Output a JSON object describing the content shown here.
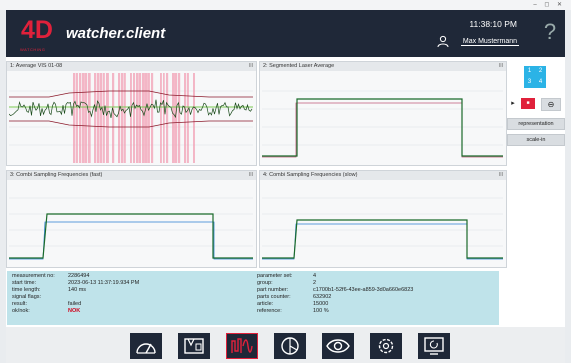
{
  "window": {
    "controls": "– ◻ ✕"
  },
  "header": {
    "logo_text": "4D",
    "logo_sub": "WATCHING",
    "title": "watcher.client",
    "time": "11:38:10 PM",
    "user_name": "Max Mustermann",
    "help_glyph": "?"
  },
  "panels": [
    {
      "title": "1: Average VIS 01-08",
      "menu": "III"
    },
    {
      "title": "2: Segmented Laser Average",
      "menu": "III"
    },
    {
      "title": "3: Combi Sampling Frequencies (fast)",
      "menu": "III"
    },
    {
      "title": "4: Combi Sampling Frequencies (slow)",
      "menu": "III"
    }
  ],
  "info_left": [
    {
      "label": "measurement no:",
      "value": "2286494"
    },
    {
      "label": "start time:",
      "value": "2023-06-13  11:37:19.934 PM"
    },
    {
      "label": "time length:",
      "value": "140 ms"
    },
    {
      "label": "signal flags:",
      "value": ""
    },
    {
      "label": "result:",
      "value": "failed"
    },
    {
      "label": "ok/nok:",
      "value": "NOK"
    }
  ],
  "info_right": [
    {
      "label": "parameter set:",
      "value": "4"
    },
    {
      "label": "group:",
      "value": "2"
    },
    {
      "label": "part number:",
      "value": "c1700b1-52f6-43ee-a859-3d0a660e6823"
    },
    {
      "label": "parts counter:",
      "value": "632902"
    },
    {
      "label": "article:",
      "value": "15000"
    },
    {
      "label": "reference:",
      "value": "100 %"
    }
  ],
  "side": {
    "grid_labels": [
      "1",
      "2",
      "3",
      "4"
    ],
    "play_glyph": "▸",
    "stop_glyph": "■",
    "zoom_glyph": "⊖",
    "representation_label": "representation",
    "scale_label": "scale-in"
  },
  "colors": {
    "header_bg": "#1f2838",
    "brand_red": "#e0213b",
    "info_bg": "#bfe3ea",
    "grid_blue": "#2bb3e6",
    "signal_green": "#1a7a2e",
    "nok_red": "#d0021b"
  },
  "toolbar": {
    "buttons": [
      {
        "icon": "gauge-icon"
      },
      {
        "icon": "book-icon"
      },
      {
        "icon": "signal-icon",
        "active": true
      },
      {
        "icon": "shield-icon"
      },
      {
        "icon": "eye-icon"
      },
      {
        "icon": "gear-icon"
      },
      {
        "icon": "monitor-icon"
      }
    ]
  }
}
